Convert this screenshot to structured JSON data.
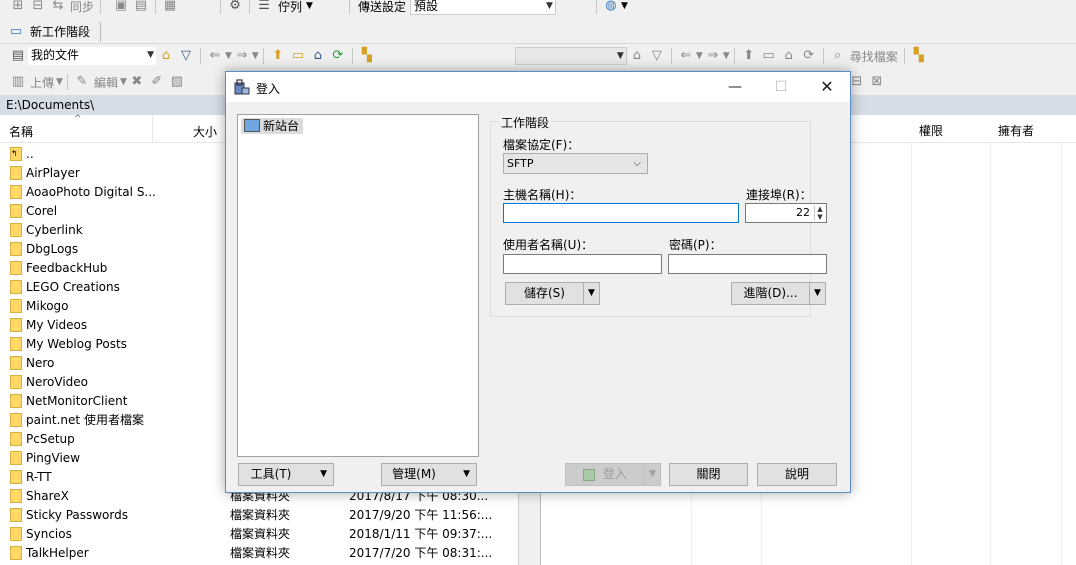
{
  "toolbar1": {
    "sync_label": "同步",
    "queue_label": "佇列",
    "transfer_settings_label": "傳送設定",
    "transfer_preset": "預設"
  },
  "toolbar2": {
    "new_session_label": "新工作階段"
  },
  "toolbar3": {
    "left_location": "我的文件",
    "find_files_label": "尋找檔案"
  },
  "toolbar4": {
    "upload_label": "上傳",
    "edit_label": "編輯"
  },
  "path": "E:\\Documents\\",
  "left_panel": {
    "columns": {
      "name": "名稱",
      "size": "大小"
    },
    "parent_dir": "..",
    "files": [
      {
        "name": "AirPlayer"
      },
      {
        "name": "AoaoPhoto Digital S..."
      },
      {
        "name": "Corel"
      },
      {
        "name": "Cyberlink"
      },
      {
        "name": "DbgLogs"
      },
      {
        "name": "FeedbackHub"
      },
      {
        "name": "LEGO Creations"
      },
      {
        "name": "Mikogo"
      },
      {
        "name": "My Videos"
      },
      {
        "name": "My Weblog Posts"
      },
      {
        "name": "Nero"
      },
      {
        "name": "NeroVideo"
      },
      {
        "name": "NetMonitorClient"
      },
      {
        "name": "paint.net 使用者檔案"
      },
      {
        "name": "PcSetup"
      },
      {
        "name": "PingView"
      },
      {
        "name": "R-TT"
      },
      {
        "name": "ShareX",
        "type": "檔案資料夾",
        "date": "2017/8/17 下午 08:30..."
      },
      {
        "name": "Sticky Passwords",
        "type": "檔案資料夾",
        "date": "2017/9/20 下午 11:56:..."
      },
      {
        "name": "Syncios",
        "type": "檔案資料夾",
        "date": "2018/1/11 下午 09:37:..."
      },
      {
        "name": "TalkHelper",
        "type": "檔案資料夾",
        "date": "2017/7/20 下午 08:31:..."
      }
    ]
  },
  "right_panel": {
    "columns": {
      "permissions": "權限",
      "owner": "擁有者"
    }
  },
  "login_dialog": {
    "title": "登入",
    "site_tree": {
      "new_site": "新站台"
    },
    "session_group": "工作階段",
    "protocol_label": "檔案協定(F)：",
    "protocol_value": "SFTP",
    "host_label": "主機名稱(H)：",
    "host_value": "",
    "port_label": "連接埠(R)：",
    "port_value": "22",
    "user_label": "使用者名稱(U)：",
    "user_value": "",
    "password_label": "密碼(P)：",
    "password_value": "",
    "save_button": "儲存(S)",
    "advanced_button": "進階(D)...",
    "tools_button": "工具(T)",
    "manage_button": "管理(M)",
    "login_button": "登入",
    "close_button": "關閉",
    "help_button": "說明"
  }
}
